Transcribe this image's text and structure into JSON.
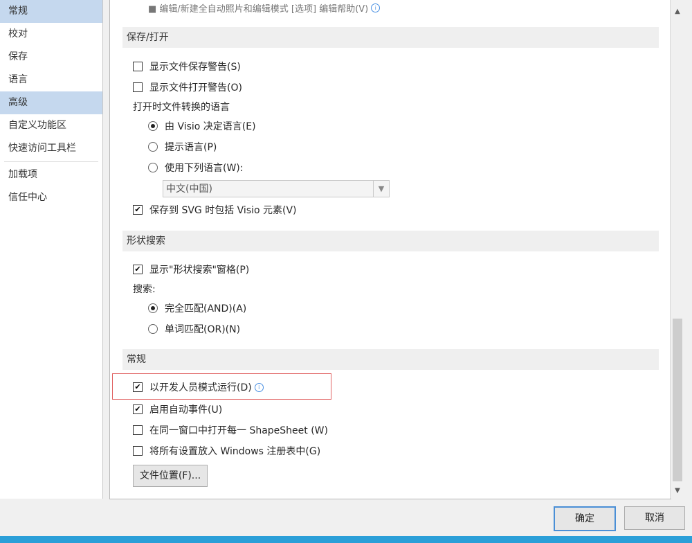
{
  "sidebar": {
    "items": [
      {
        "label": "常规",
        "selected": true
      },
      {
        "label": "校对",
        "selected": false
      },
      {
        "label": "保存",
        "selected": false
      },
      {
        "label": "语言",
        "selected": false
      },
      {
        "label": "高级",
        "selected": true
      },
      {
        "label": "自定义功能区",
        "selected": false
      },
      {
        "label": "快速访问工具栏",
        "selected": false
      },
      {
        "label": "加载项",
        "selected": false
      },
      {
        "label": "信任中心",
        "selected": false
      }
    ]
  },
  "content": {
    "partial_top": "■ 编辑/新建全自动照片和编辑模式 [选项] 编辑帮助(V)",
    "save_open": {
      "header": "保存/打开",
      "show_save_warning": {
        "label": "显示文件保存警告(S)",
        "checked": false
      },
      "show_open_warning": {
        "label": "显示文件打开警告(O)",
        "checked": false
      },
      "lang_group_label": "打开时文件转换的语言",
      "radio_visio": {
        "label": "由 Visio 决定语言(E)",
        "selected": true
      },
      "radio_prompt": {
        "label": "提示语言(P)",
        "selected": false
      },
      "radio_use": {
        "label": "使用下列语言(W):",
        "selected": false
      },
      "language_select": "中文(中国)",
      "svg_include": {
        "label": "保存到 SVG 时包括 Visio 元素(V)",
        "checked": true
      }
    },
    "shape_search": {
      "header": "形状搜索",
      "show_pane": {
        "label": "显示\"形状搜索\"窗格(P)",
        "checked": true
      },
      "search_label": "搜索:",
      "radio_and": {
        "label": "完全匹配(AND)(A)",
        "selected": true
      },
      "radio_or": {
        "label": "单词匹配(OR)(N)",
        "selected": false
      }
    },
    "general": {
      "header": "常规",
      "developer_mode": {
        "label": "以开发人员模式运行(D)",
        "checked": true
      },
      "auto_events": {
        "label": "启用自动事件(U)",
        "checked": true
      },
      "shapesheet_window": {
        "label": "在同一窗口中打开每一 ShapeSheet (W)",
        "checked": false
      },
      "registry": {
        "label": "将所有设置放入 Windows 注册表中(G)",
        "checked": false
      },
      "file_location_button": "文件位置(F)..."
    }
  },
  "footer": {
    "ok": "确定",
    "cancel": "取消"
  },
  "icons": {
    "check": "✔",
    "scroll_up": "▲",
    "scroll_down": "▼",
    "dropdown": "▼",
    "info": "i"
  }
}
